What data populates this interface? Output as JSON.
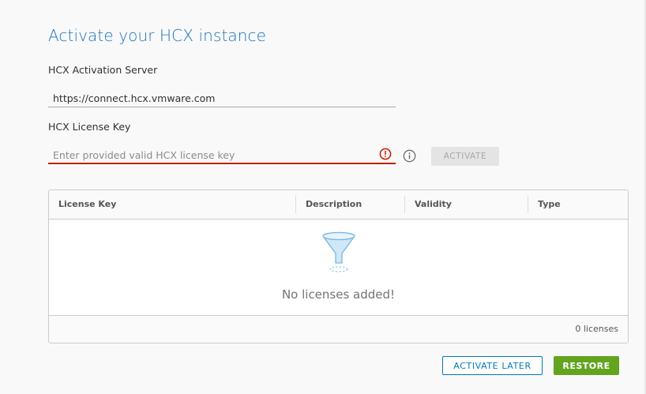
{
  "title": "Activate your HCX instance",
  "activation_server": {
    "label": "HCX Activation Server",
    "value": "https://connect.hcx.vmware.com"
  },
  "license_key": {
    "label": "HCX License Key",
    "placeholder": "Enter provided valid HCX license key",
    "state": "invalid"
  },
  "activate_button": "ACTIVATE",
  "license_grid": {
    "columns": [
      "License Key",
      "Description",
      "Validity",
      "Type"
    ],
    "empty_message": "No licenses added!",
    "footer": "0 licenses"
  },
  "activate_later_button": "ACTIVATE LATER",
  "restore_button": "RESTORE",
  "colors": {
    "accent": "#0079b8",
    "title": "#1b75bb",
    "error": "#c21d00",
    "success": "#62a420"
  }
}
